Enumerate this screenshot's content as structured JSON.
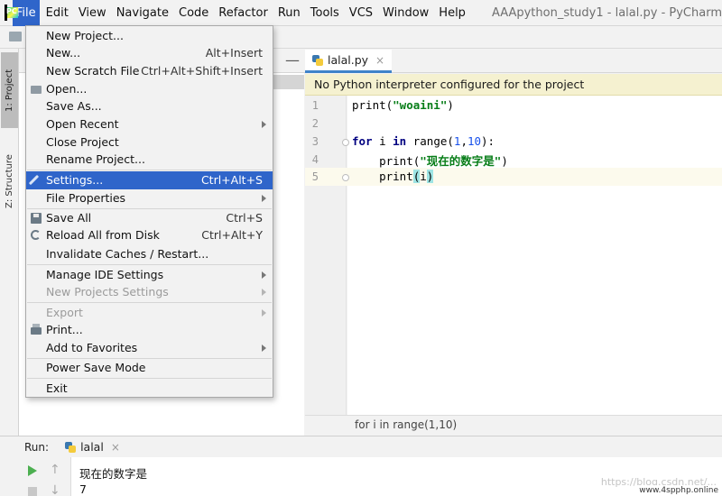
{
  "menubar": {
    "items": [
      "File",
      "Edit",
      "View",
      "Navigate",
      "Code",
      "Refactor",
      "Run",
      "Tools",
      "VCS",
      "Window",
      "Help"
    ],
    "window_title": "AAApython_study1 - lalal.py - PyCharm"
  },
  "left_strip": {
    "project_tab": "1: Project",
    "structure_tab": "Z: Structure"
  },
  "file_menu": {
    "new_project": "New Project...",
    "new": "New...",
    "new_shortcut": "Alt+Insert",
    "new_scratch": "New Scratch File",
    "new_scratch_shortcut": "Ctrl+Alt+Shift+Insert",
    "open": "Open...",
    "save_as": "Save As...",
    "open_recent": "Open Recent",
    "close_project": "Close Project",
    "rename_project": "Rename Project...",
    "settings": "Settings...",
    "settings_shortcut": "Ctrl+Alt+S",
    "file_properties": "File Properties",
    "save_all": "Save All",
    "save_all_shortcut": "Ctrl+S",
    "reload_all": "Reload All from Disk",
    "reload_all_shortcut": "Ctrl+Alt+Y",
    "invalidate_caches": "Invalidate Caches / Restart...",
    "manage_ide_settings": "Manage IDE Settings",
    "new_projects_settings": "New Projects Settings",
    "export": "Export",
    "print": "Print...",
    "add_to_favorites": "Add to Favorites",
    "power_save_mode": "Power Save Mode",
    "exit": "Exit"
  },
  "editor": {
    "tab_name": "lalal.py",
    "tab_close": "×",
    "banner": "No Python interpreter configured for the project",
    "line_numbers": [
      "1",
      "2",
      "3",
      "4",
      "5"
    ],
    "code": {
      "l1_fn": "print(",
      "l1_str": "\"woaini\"",
      "l1_end": ")",
      "l3_kw1": "for",
      "l3_mid": " i ",
      "l3_kw2": "in",
      "l3_fn": " range(",
      "l3_n1": "1",
      "l3_comma": ",",
      "l3_n2": "10",
      "l3_end": "):",
      "l4_fn": "    print(",
      "l4_str": "\"现在的数字是\"",
      "l4_end": ")",
      "l5_fn": "    print",
      "l5_open": "(",
      "l5_arg": "i",
      "l5_close": ")"
    },
    "breadcrumb": "for i in range(1,10)"
  },
  "run_panel": {
    "title": "Run:",
    "tab_name": "lalal",
    "tab_close": "×",
    "output": [
      "现在的数字是",
      "7"
    ]
  },
  "watermark": "https://blog.csdn.net/...",
  "site_badge": "www.4spphp.online",
  "colors": {
    "accent": "#2f65ca",
    "banner_bg": "#f5f1d0",
    "keyword": "#000080",
    "string": "#067d17",
    "number": "#1750eb"
  }
}
